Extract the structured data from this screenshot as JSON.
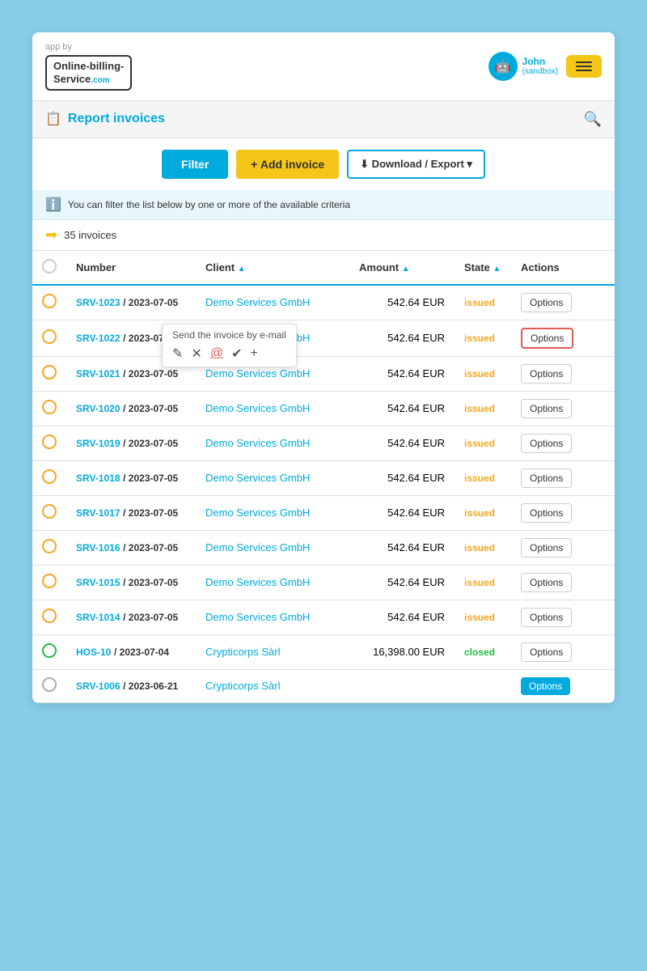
{
  "header": {
    "app_by": "app by",
    "logo_line1": "Online-billing-",
    "logo_line2": "Service",
    "logo_com": ".com",
    "user_name": "John",
    "user_role": "(sandbox)",
    "avatar_symbol": "🤖"
  },
  "page_title": "Report invoices",
  "search_placeholder": "Search",
  "toolbar": {
    "filter_label": "Filter",
    "add_invoice_label": "+ Add invoice",
    "download_label": "⬇ Download / Export ▾"
  },
  "info_message": "You can filter the list below by one or more of the available criteria",
  "count_label": "35 invoices",
  "table": {
    "columns": [
      "",
      "Number",
      "Client",
      "Amount",
      "State",
      "Actions"
    ],
    "sort_indicators": {
      "client": "▲",
      "amount": "▲",
      "state": "▲"
    },
    "rows": [
      {
        "id": "SRV-1023",
        "date": "2023-07-05",
        "client": "Demo Services GmbH",
        "amount": "542.64 EUR",
        "state": "issued",
        "radio": "orange"
      },
      {
        "id": "SRV-1022",
        "date": "2023-07-05",
        "client": "Demo Services GmbH",
        "amount": "542.64 EUR",
        "state": "issued",
        "radio": "orange",
        "tooltip": true
      },
      {
        "id": "SRV-1021",
        "date": "2023-07-05",
        "client": "Demo Services GmbH",
        "amount": "542.64 EUR",
        "state": "issued",
        "radio": "orange"
      },
      {
        "id": "SRV-1020",
        "date": "2023-07-05",
        "client": "Demo Services GmbH",
        "amount": "542.64 EUR",
        "state": "issued",
        "radio": "orange"
      },
      {
        "id": "SRV-1019",
        "date": "2023-07-05",
        "client": "Demo Services GmbH",
        "amount": "542.64 EUR",
        "state": "issued",
        "radio": "orange"
      },
      {
        "id": "SRV-1018",
        "date": "2023-07-05",
        "client": "Demo Services GmbH",
        "amount": "542.64 EUR",
        "state": "issued",
        "radio": "orange"
      },
      {
        "id": "SRV-1017",
        "date": "2023-07-05",
        "client": "Demo Services GmbH",
        "amount": "542.64 EUR",
        "state": "issued",
        "radio": "orange"
      },
      {
        "id": "SRV-1016",
        "date": "2023-07-05",
        "client": "Demo Services GmbH",
        "amount": "542.64 EUR",
        "state": "issued",
        "radio": "orange"
      },
      {
        "id": "SRV-1015",
        "date": "2023-07-05",
        "client": "Demo Services GmbH",
        "amount": "542.64 EUR",
        "state": "issued",
        "radio": "orange"
      },
      {
        "id": "SRV-1014",
        "date": "2023-07-05",
        "client": "Demo Services GmbH",
        "amount": "542.64 EUR",
        "state": "issued",
        "radio": "orange"
      },
      {
        "id": "HOS-10",
        "date": "2023-07-04",
        "client": "Crypticorps Sàrl",
        "amount": "16,398.00 EUR",
        "state": "closed",
        "radio": "green"
      },
      {
        "id": "SRV-1006",
        "date": "2023-06-21",
        "client": "Crypticorps Sàrl",
        "amount": "",
        "state": "",
        "radio": "gray"
      }
    ]
  },
  "tooltip": {
    "label": "Send the invoice by e-mail",
    "icons": [
      "✎",
      "✕",
      "@",
      "✔",
      "+"
    ]
  }
}
